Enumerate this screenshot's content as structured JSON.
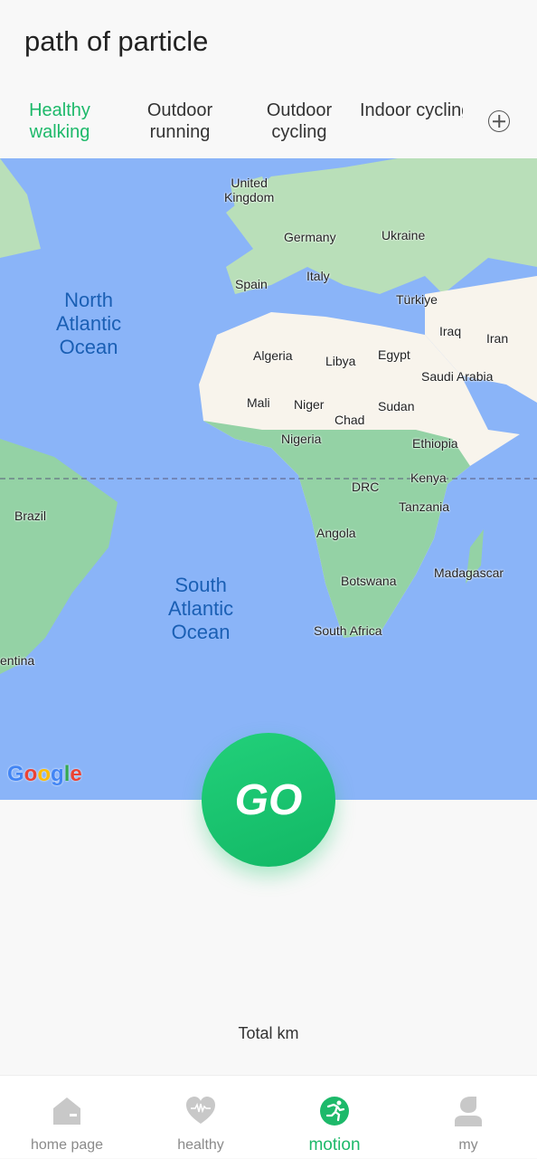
{
  "header": {
    "title": "path of particle"
  },
  "tabs": [
    {
      "label": "Healthy\nwalking",
      "active": true
    },
    {
      "label": "Outdoor\nrunning"
    },
    {
      "label": "Outdoor\ncycling"
    },
    {
      "label": "Indoor cycling"
    }
  ],
  "add_tab_icon": "plus-circle-icon",
  "map": {
    "oceans": {
      "north_atlantic": "North\nAtlantic\nOcean",
      "south_atlantic": "South\nAtlantic\nOcean"
    },
    "labels": {
      "uk": "United\nKingdom",
      "germany": "Germany",
      "ukraine": "Ukraine",
      "spain": "Spain",
      "italy": "Italy",
      "turkiye": "Türkiye",
      "iraq": "Iraq",
      "iran": "Iran",
      "algeria": "Algeria",
      "libya": "Libya",
      "egypt": "Egypt",
      "saudi": "Saudi Arabia",
      "mali": "Mali",
      "niger": "Niger",
      "chad": "Chad",
      "sudan": "Sudan",
      "nigeria": "Nigeria",
      "ethiopia": "Ethiopia",
      "kenya": "Kenya",
      "drc": "DRC",
      "tanzania": "Tanzania",
      "brazil": "Brazil",
      "angola": "Angola",
      "madagascar": "Madagascar",
      "botswana": "Botswana",
      "south_africa": "South Africa",
      "argentina": "entina"
    },
    "attribution": "Google"
  },
  "go_button": "GO",
  "stats": {
    "total_label": "Total km"
  },
  "colors": {
    "accent": "#1db96a",
    "water": "#8ab4f8",
    "desert": "#f8f4ec",
    "vegetation": "#94d2a5"
  },
  "nav": [
    {
      "label": "home page",
      "icon": "home-icon"
    },
    {
      "label": "healthy",
      "icon": "heart-pulse-icon"
    },
    {
      "label": "motion",
      "icon": "running-icon",
      "active": true
    },
    {
      "label": "my",
      "icon": "person-icon"
    }
  ]
}
